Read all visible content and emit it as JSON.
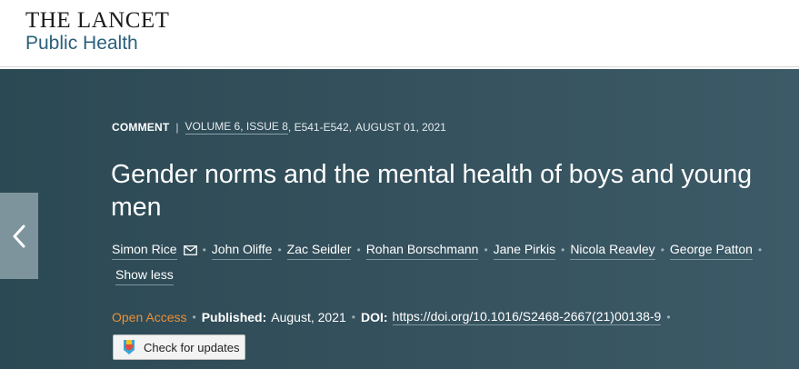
{
  "journal": {
    "name_line1": "THE LANCET",
    "name_line2": "Public Health"
  },
  "article": {
    "type": "COMMENT",
    "volume_issue": "VOLUME 6, ISSUE 8",
    "pages": ", E541-E542,",
    "date": "AUGUST 01, 2021",
    "title": "Gender norms and the mental health of boys and young men",
    "authors": [
      "Simon Rice",
      "John Oliffe",
      "Zac Seidler",
      "Rohan Borschmann",
      "Jane Pirkis",
      "Nicola Reavley",
      "George Patton"
    ],
    "show_less_label": "Show less",
    "open_access_label": "Open Access",
    "published_label": "Published:",
    "published_value": "August, 2021",
    "doi_label": "DOI:",
    "doi_value": "https://doi.org/10.1016/S2468-2667(21)00138-9",
    "check_updates_label": "Check for updates"
  },
  "colors": {
    "hero_bg": "#34505c",
    "open_access": "#e8903a",
    "journal_subtitle": "#2a5f7c"
  },
  "icons": {
    "prev": "chevron-left-icon",
    "email": "mail-icon",
    "updates": "crossmark-icon"
  }
}
